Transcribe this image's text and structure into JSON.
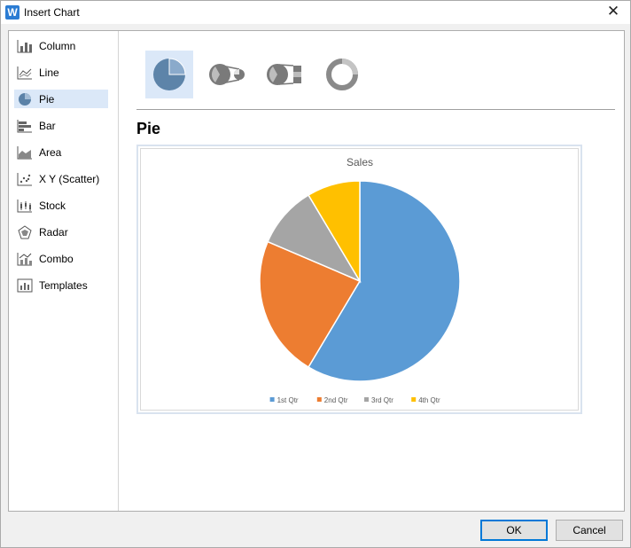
{
  "window": {
    "title": "Insert Chart",
    "close_glyph": "✕"
  },
  "sidebar": {
    "items": [
      {
        "label": "Column",
        "icon": "column-chart-icon"
      },
      {
        "label": "Line",
        "icon": "line-chart-icon"
      },
      {
        "label": "Pie",
        "icon": "pie-chart-icon",
        "selected": true
      },
      {
        "label": "Bar",
        "icon": "bar-chart-icon"
      },
      {
        "label": "Area",
        "icon": "area-chart-icon"
      },
      {
        "label": "X Y (Scatter)",
        "icon": "scatter-chart-icon"
      },
      {
        "label": "Stock",
        "icon": "stock-chart-icon"
      },
      {
        "label": "Radar",
        "icon": "radar-chart-icon"
      },
      {
        "label": "Combo",
        "icon": "combo-chart-icon"
      },
      {
        "label": "Templates",
        "icon": "templates-icon"
      }
    ]
  },
  "subtypes": [
    {
      "icon": "pie-subtype-icon",
      "selected": true
    },
    {
      "icon": "pie-of-pie-icon"
    },
    {
      "icon": "bar-of-pie-icon"
    },
    {
      "icon": "doughnut-icon"
    }
  ],
  "preview": {
    "heading": "Pie"
  },
  "chart_data": {
    "type": "pie",
    "title": "Sales",
    "categories": [
      "1st Qtr",
      "2nd Qtr",
      "3rd Qtr",
      "4th Qtr"
    ],
    "values": [
      8.2,
      3.2,
      1.4,
      1.2
    ],
    "colors": [
      "#5b9bd5",
      "#ed7d31",
      "#a5a5a5",
      "#ffc000"
    ],
    "legend_position": "bottom"
  },
  "buttons": {
    "ok": "OK",
    "cancel": "Cancel"
  },
  "colors": {
    "accent": "#0078d7",
    "selection": "#dbe8f8"
  }
}
